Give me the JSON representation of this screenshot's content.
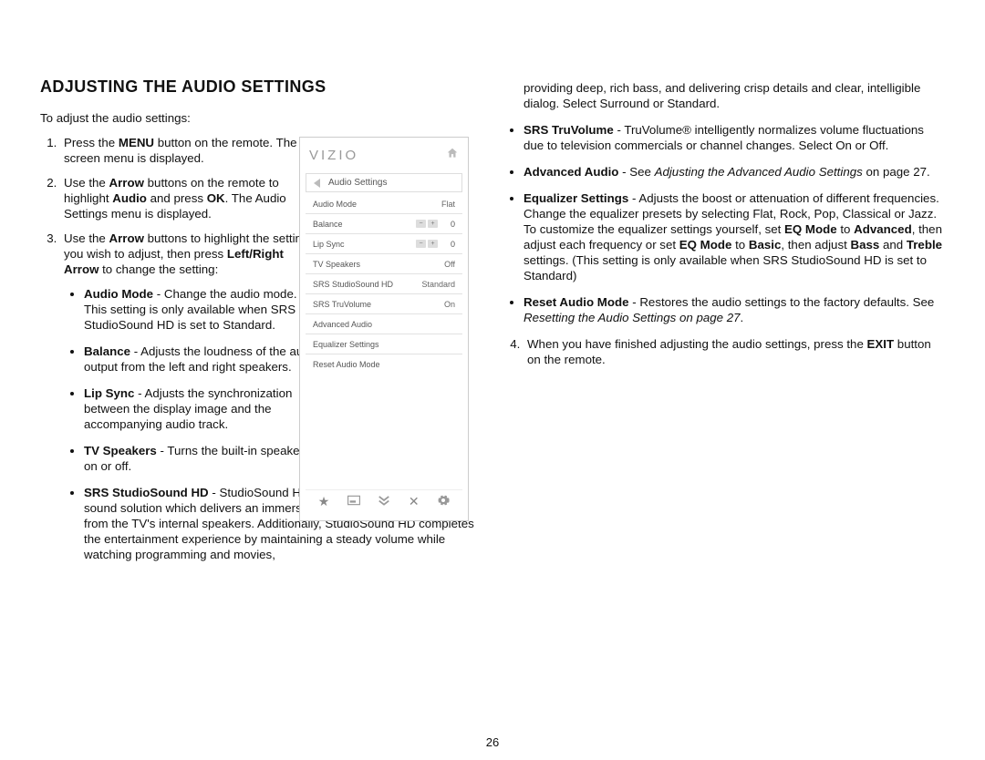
{
  "heading": "ADJUSTING THE AUDIO SETTINGS",
  "intro": "To adjust the audio settings:",
  "steps": {
    "s1": [
      {
        "t": "Press the "
      },
      {
        "b": "MENU"
      },
      {
        "t": " button on the remote. The on-screen menu is displayed."
      }
    ],
    "s2": [
      {
        "t": "Use the "
      },
      {
        "b": "Arrow"
      },
      {
        "t": " buttons on the remote to highlight "
      },
      {
        "b": "Audio"
      },
      {
        "t": " and press "
      },
      {
        "b": "OK"
      },
      {
        "t": ". The Audio Settings menu is displayed."
      }
    ],
    "s3": [
      {
        "t": "Use the "
      },
      {
        "b": "Arrow"
      },
      {
        "t": " buttons to highlight the setting you wish to adjust, then press "
      },
      {
        "b": "Left/Right Arrow"
      },
      {
        "t": " to change the setting:"
      }
    ],
    "s4": [
      {
        "t": "When you have finished adjusting the audio settings, press the "
      },
      {
        "b": "EXIT"
      },
      {
        "t": " button on the remote."
      }
    ]
  },
  "bullets": {
    "left_narrow": [
      [
        {
          "b": "Audio Mode"
        },
        {
          "t": " - Change the audio mode. This setting is only available when SRS StudioSound HD is set to Standard."
        }
      ],
      [
        {
          "b": "Balance"
        },
        {
          "t": " - Adjusts the loudness of the audio output from the left and right speakers."
        }
      ],
      [
        {
          "b": "Lip Sync"
        },
        {
          "t": " - Adjusts the syn­chronization between the display image and the accompanying audio track."
        }
      ],
      [
        {
          "b": "TV Speakers"
        },
        {
          "t": " - Turns the built-in speakers on or off."
        }
      ]
    ],
    "left_wide": [
      [
        {
          "b": "SRS StudioSound HD"
        },
        {
          "t": " - StudioSound HD™ is a feature-rich surround sound solution which delivers an immersive surround sound experience from the TV's internal speakers. Additionally, StudioSound HD completes the entertainment experience by maintaining a steady volume while watching programming and movies,"
        }
      ]
    ],
    "right_cont": [
      {
        "t": "providing deep, rich bass, and delivering crisp details and clear, intelligible dialog. Select Surround or Standard."
      }
    ],
    "right": [
      [
        {
          "b": "SRS TruVolume"
        },
        {
          "t": " - TruVolume® intelligently normalizes volume fluctuations due to television commercials or channel changes. Select On or Off."
        }
      ],
      [
        {
          "b": "Advanced Audio"
        },
        {
          "t": " - See "
        },
        {
          "i": "Adjusting the Advanced Audio Settings"
        },
        {
          "t": " on page 27."
        }
      ],
      [
        {
          "b": "Equalizer Settings"
        },
        {
          "t": " - Adjusts the boost or attenuation of different frequencies. Change the equalizer presets by selecting Flat, Rock, Pop, Classical or Jazz. To customize the equalizer settings yourself, set "
        },
        {
          "b": "EQ Mode"
        },
        {
          "t": " to "
        },
        {
          "b": "Advanced"
        },
        {
          "t": ", then adjust each frequency or set "
        },
        {
          "b": "EQ Mode"
        },
        {
          "t": " to "
        },
        {
          "b": "Basic"
        },
        {
          "t": ", then adjust "
        },
        {
          "b": "Bass"
        },
        {
          "t": " and "
        },
        {
          "b": "Treble"
        },
        {
          "t": " settings. (This setting is only available when SRS StudioSound HD is set to Standard)"
        }
      ],
      [
        {
          "b": "Reset Audio Mode"
        },
        {
          "t": " - Restores the audio settings to the factory defaults. See "
        },
        {
          "i": "Resetting the Audio Settings on page 27"
        },
        {
          "t": "."
        }
      ]
    ]
  },
  "osd": {
    "brand": "VIZIO",
    "section": "Audio Settings",
    "rows": [
      {
        "label": "Audio Mode",
        "value": "Flat",
        "kind": "text"
      },
      {
        "label": "Balance",
        "value": "0",
        "kind": "slider"
      },
      {
        "label": "Lip Sync",
        "value": "0",
        "kind": "slider"
      },
      {
        "label": "TV Speakers",
        "value": "Off",
        "kind": "text"
      },
      {
        "label": "SRS StudioSound HD",
        "value": "Standard",
        "kind": "text"
      },
      {
        "label": "SRS TruVolume",
        "value": "On",
        "kind": "text"
      },
      {
        "label": "Advanced Audio",
        "value": "",
        "kind": "text"
      },
      {
        "label": "Equalizer Settings",
        "value": "",
        "kind": "text"
      },
      {
        "label": "Reset Audio Mode",
        "value": "",
        "kind": "text"
      }
    ]
  },
  "page_number": "26"
}
